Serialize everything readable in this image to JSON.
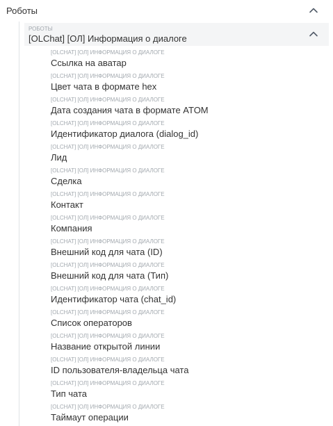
{
  "section": {
    "title": "Роботы"
  },
  "group": {
    "caption": "РОБОТЫ",
    "title": "[OLChat] [ОЛ] Информация о диалоге"
  },
  "items": [
    {
      "caption": "[OLCHAT] [ОЛ] ИНФОРМАЦИЯ О ДИАЛОГЕ",
      "label": "Ссылка на аватар"
    },
    {
      "caption": "[OLCHAT] [ОЛ] ИНФОРМАЦИЯ О ДИАЛОГЕ",
      "label": "Цвет чата в формате hex"
    },
    {
      "caption": "[OLCHAT] [ОЛ] ИНФОРМАЦИЯ О ДИАЛОГЕ",
      "label": "Дата создания чата в формате ATOM"
    },
    {
      "caption": "[OLCHAT] [ОЛ] ИНФОРМАЦИЯ О ДИАЛОГЕ",
      "label": "Идентификатор диалога (dialog_id)"
    },
    {
      "caption": "[OLCHAT] [ОЛ] ИНФОРМАЦИЯ О ДИАЛОГЕ",
      "label": "Лид"
    },
    {
      "caption": "[OLCHAT] [ОЛ] ИНФОРМАЦИЯ О ДИАЛОГЕ",
      "label": "Сделка"
    },
    {
      "caption": "[OLCHAT] [ОЛ] ИНФОРМАЦИЯ О ДИАЛОГЕ",
      "label": "Контакт"
    },
    {
      "caption": "[OLCHAT] [ОЛ] ИНФОРМАЦИЯ О ДИАЛОГЕ",
      "label": "Компания"
    },
    {
      "caption": "[OLCHAT] [ОЛ] ИНФОРМАЦИЯ О ДИАЛОГЕ",
      "label": "Внешний код для чата (ID)"
    },
    {
      "caption": "[OLCHAT] [ОЛ] ИНФОРМАЦИЯ О ДИАЛОГЕ",
      "label": "Внешний код для чата (Тип)"
    },
    {
      "caption": "[OLCHAT] [ОЛ] ИНФОРМАЦИЯ О ДИАЛОГЕ",
      "label": "Идентификатор чата (chat_id)"
    },
    {
      "caption": "[OLCHAT] [ОЛ] ИНФОРМАЦИЯ О ДИАЛОГЕ",
      "label": "Список операторов"
    },
    {
      "caption": "[OLCHAT] [ОЛ] ИНФОРМАЦИЯ О ДИАЛОГЕ",
      "label": "Название открытой линии"
    },
    {
      "caption": "[OLCHAT] [ОЛ] ИНФОРМАЦИЯ О ДИАЛОГЕ",
      "label": "ID пользователя-владельца чата"
    },
    {
      "caption": "[OLCHAT] [ОЛ] ИНФОРМАЦИЯ О ДИАЛОГЕ",
      "label": "Тип чата"
    },
    {
      "caption": "[OLCHAT] [ОЛ] ИНФОРМАЦИЯ О ДИАЛОГЕ",
      "label": "Таймаут операции"
    }
  ],
  "icons": {
    "collapse": "chevron-up-icon"
  },
  "colors": {
    "text": "#333333",
    "caption": "#a2a8ae",
    "header_bg": "#f4f5f6",
    "tree_line": "#e0e3e6"
  }
}
